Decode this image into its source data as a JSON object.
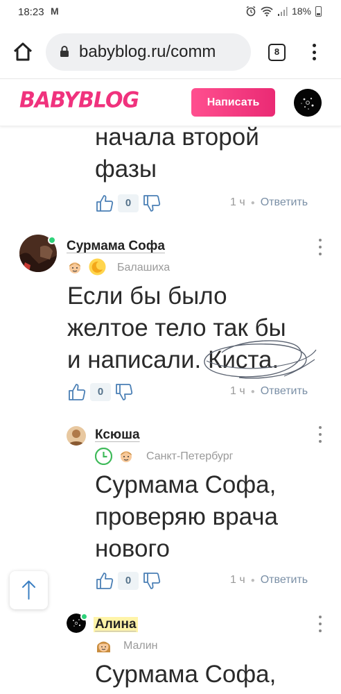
{
  "status_bar": {
    "time": "18:23",
    "mail_icon": "M",
    "battery": "18%"
  },
  "browser": {
    "url": "babyblog.ru/comm",
    "tab_count": "8"
  },
  "site": {
    "logo": "BABYBLOG",
    "write_button": "Написать",
    "brand_color": "#f0327d"
  },
  "comments": [
    {
      "text_lines": [
        "начала второй",
        "фазы"
      ],
      "likes": "0",
      "time": "1 ч",
      "reply": "Ответить"
    },
    {
      "author": "Сурмама Софа",
      "city": "Балашиха",
      "online": true,
      "text_lines": [
        "Если бы было",
        "желтое тело так бы",
        "и написали. Киста."
      ],
      "likes": "0",
      "time": "1 ч",
      "reply": "Ответить"
    },
    {
      "author": "Ксюша",
      "city": "Санкт-Петербург",
      "text_lines": [
        "Сурмама Софа,",
        "проверяю врача",
        "нового"
      ],
      "likes": "0",
      "time": "1 ч",
      "reply": "Ответить"
    },
    {
      "author": "Алина",
      "city": "Малин",
      "online": true,
      "text_lines": [
        "Сурмама Софа,"
      ]
    }
  ]
}
